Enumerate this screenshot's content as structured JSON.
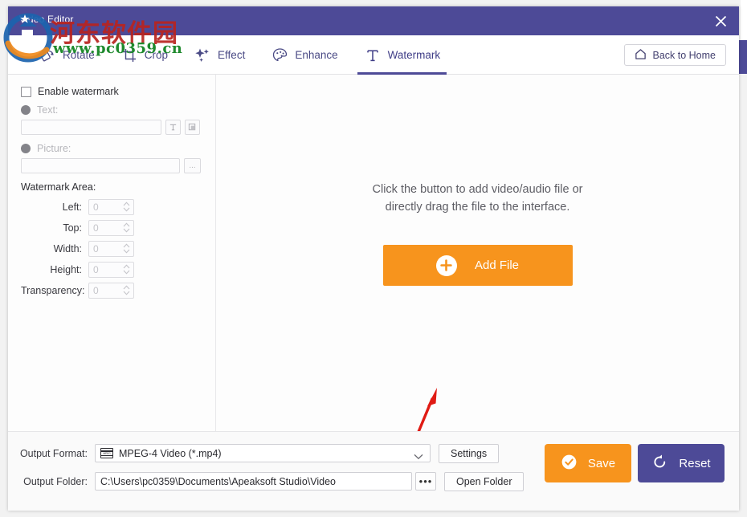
{
  "window": {
    "title": "Video Editor",
    "close_label": "close-icon"
  },
  "toolbar": {
    "tabs": [
      {
        "label": "Rotate",
        "icon": "rotate-icon",
        "active": false
      },
      {
        "label": "Crop",
        "icon": "crop-icon",
        "active": false
      },
      {
        "label": "Effect",
        "icon": "sparkle-icon",
        "active": false
      },
      {
        "label": "Enhance",
        "icon": "palette-icon",
        "active": false
      },
      {
        "label": "Watermark",
        "icon": "text-t-icon",
        "active": true
      }
    ],
    "back_home_label": "Back to Home",
    "back_home_icon": "home-icon"
  },
  "left_panel": {
    "enable_watermark_label": "Enable watermark",
    "enable_watermark_checked": false,
    "text_radio_label": "Text:",
    "text_value": "",
    "text_font_button": "T",
    "text_color_button": "color-swatch-icon",
    "picture_radio_label": "Picture:",
    "picture_value": "",
    "picture_browse_button": "...",
    "area_section_label": "Watermark Area:",
    "fields": [
      {
        "label": "Left:",
        "value": "0"
      },
      {
        "label": "Top:",
        "value": "0"
      },
      {
        "label": "Width:",
        "value": "0"
      },
      {
        "label": "Height:",
        "value": "0"
      },
      {
        "label": "Transparency:",
        "value": "0"
      }
    ]
  },
  "main": {
    "drop_message_line1": "Click the button to add video/audio file or",
    "drop_message_line2": "directly drag the file to the interface.",
    "add_file_label": "Add File",
    "add_file_icon": "plus-icon",
    "annotation_arrow": "red-arrow-annotation"
  },
  "footer": {
    "output_format_label": "Output Format:",
    "output_format_value": "MPEG-4 Video (*.mp4)",
    "output_format_icon": "film-strip-icon",
    "format_badge": "MPEG",
    "settings_label": "Settings",
    "output_folder_label": "Output Folder:",
    "output_folder_value": "C:\\Users\\pc0359\\Documents\\Apeaksoft Studio\\Video",
    "browse_label": "•••",
    "open_folder_label": "Open Folder",
    "save_label": "Save",
    "save_icon": "check-circle-icon",
    "reset_label": "Reset",
    "reset_icon": "refresh-icon"
  },
  "watermark_overlay": {
    "site_name_cn": "河东软件园",
    "site_url": "www.pc0359.cn",
    "logo_icon": "site-logo-icon"
  },
  "colors": {
    "titlebar": "#4d4a97",
    "accent_purple": "#4d4a97",
    "accent_orange": "#f7941d",
    "annotation_red": "#e01b14",
    "watermark_red": "#b9241f",
    "watermark_green": "#1f8a2e"
  }
}
